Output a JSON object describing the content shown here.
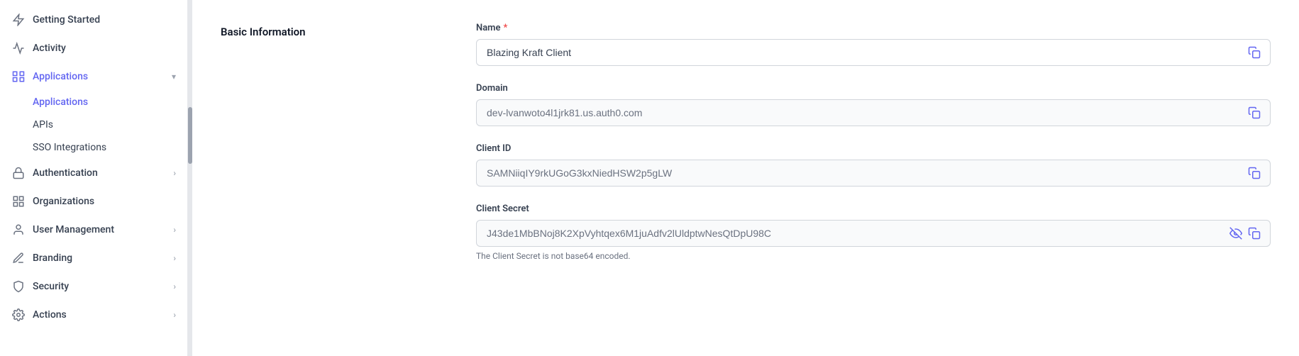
{
  "sidebar": {
    "items": [
      {
        "id": "getting-started",
        "label": "Getting Started",
        "icon": "⚡",
        "iconType": "bolt",
        "active": false,
        "hasChevron": false
      },
      {
        "id": "activity",
        "label": "Activity",
        "icon": "📈",
        "iconType": "chart",
        "active": false,
        "hasChevron": false
      },
      {
        "id": "applications",
        "label": "Applications",
        "icon": "🔷",
        "iconType": "applications",
        "active": true,
        "hasChevron": true,
        "expanded": true,
        "subItems": [
          {
            "id": "applications-sub",
            "label": "Applications",
            "active": true
          },
          {
            "id": "apis",
            "label": "APIs",
            "active": false
          },
          {
            "id": "sso-integrations",
            "label": "SSO Integrations",
            "active": false
          }
        ]
      },
      {
        "id": "authentication",
        "label": "Authentication",
        "icon": "🔒",
        "iconType": "lock",
        "active": false,
        "hasChevron": true
      },
      {
        "id": "organizations",
        "label": "Organizations",
        "icon": "⊞",
        "iconType": "grid",
        "active": false,
        "hasChevron": false
      },
      {
        "id": "user-management",
        "label": "User Management",
        "icon": "👤",
        "iconType": "user",
        "active": false,
        "hasChevron": true
      },
      {
        "id": "branding",
        "label": "Branding",
        "icon": "✏️",
        "iconType": "pencil",
        "active": false,
        "hasChevron": true
      },
      {
        "id": "security",
        "label": "Security",
        "icon": "🛡",
        "iconType": "shield",
        "active": false,
        "hasChevron": true
      },
      {
        "id": "actions",
        "label": "Actions",
        "icon": "⚙",
        "iconType": "gear",
        "active": false,
        "hasChevron": true
      }
    ]
  },
  "main": {
    "section_title": "Basic Information",
    "fields": {
      "name": {
        "label": "Name",
        "required": true,
        "value": "Blazing Kraft Client",
        "readonly": false,
        "placeholder": ""
      },
      "domain": {
        "label": "Domain",
        "required": false,
        "value": "dev-lvanwoto4l1jrk81.us.auth0.com",
        "readonly": true,
        "placeholder": ""
      },
      "client_id": {
        "label": "Client ID",
        "required": false,
        "value": "SAMNiiqIY9rkUGoG3kxNiedHSW2p5gLW",
        "readonly": true,
        "placeholder": ""
      },
      "client_secret": {
        "label": "Client Secret",
        "required": false,
        "value": "J43de1MbBNoj8K2XpVyhtqex6M1juAdfv2lUldptwNesQtDpU98C",
        "readonly": true,
        "placeholder": "",
        "hint": "The Client Secret is not base64 encoded.",
        "has_visibility_toggle": true
      }
    },
    "required_label": "*"
  }
}
